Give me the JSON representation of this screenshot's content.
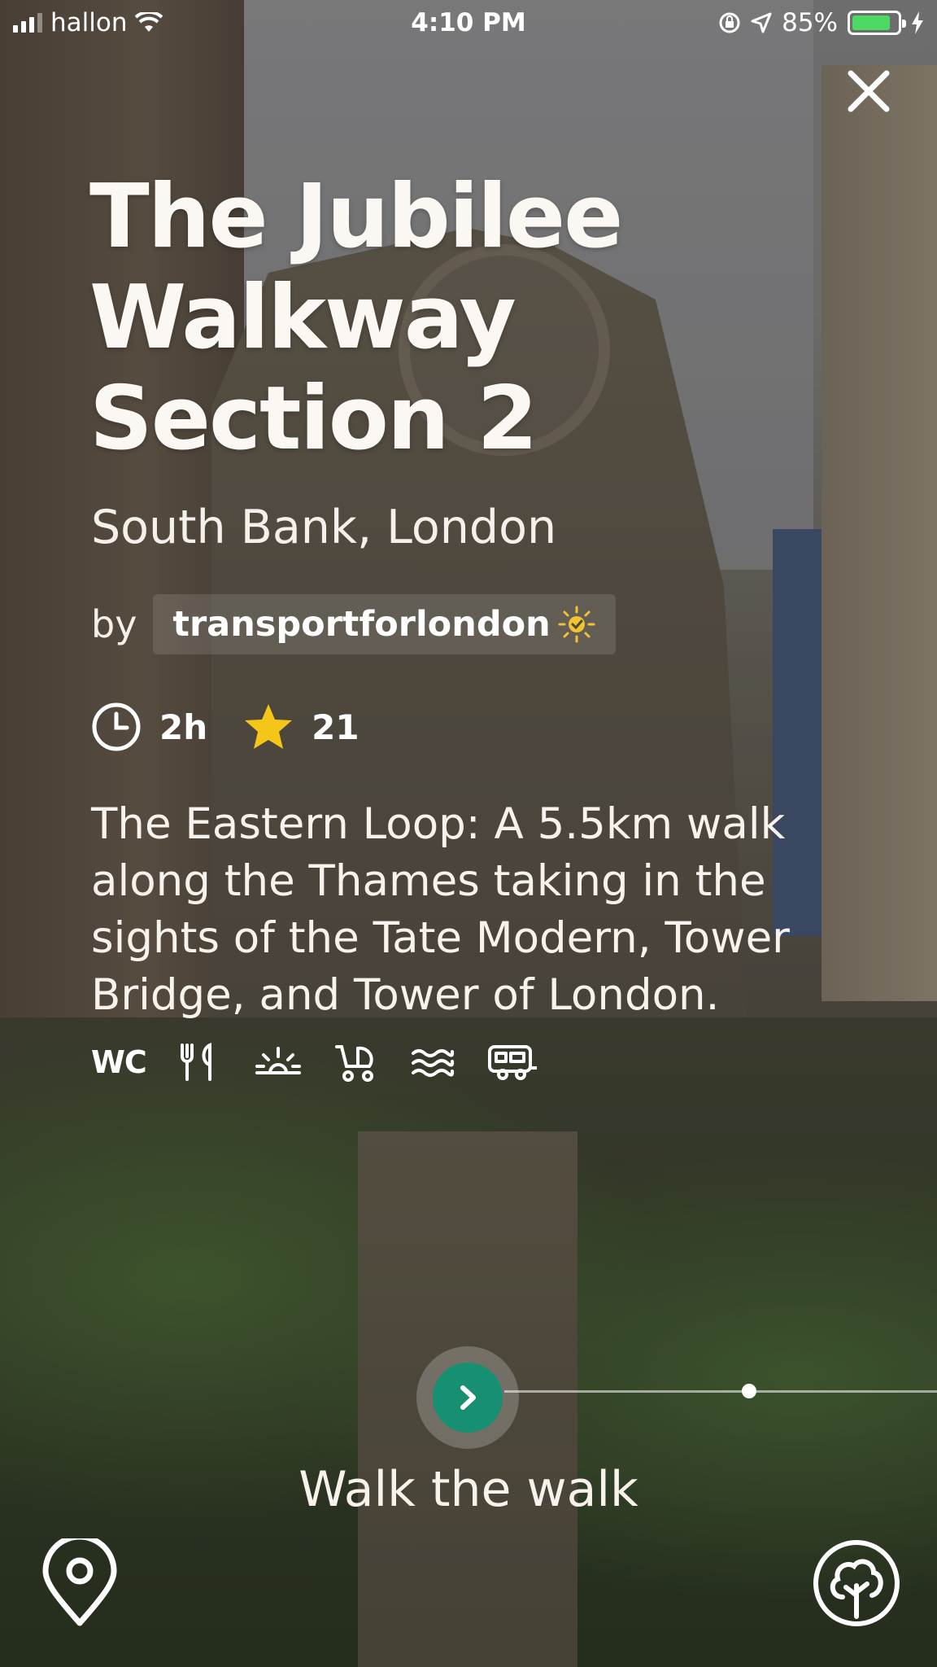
{
  "status_bar": {
    "carrier": "hallon",
    "time": "4:10 PM",
    "battery": "85%",
    "battery_level": 0.85,
    "battery_color": "#4cd964"
  },
  "close_icon": "close-icon",
  "walk": {
    "title_lines": [
      "The Jubilee",
      "Walkway",
      "Section 2"
    ],
    "location": "South Bank, London",
    "by_label": "by",
    "author": "transportforlondon",
    "author_badge_icon": "sun-badge-icon",
    "duration": "2h",
    "rating": "21",
    "description": "The Eastern Loop: A 5.5km walk along the Thames taking in the sights of the Tate Modern, Tower Bridge, and Tower of London.",
    "amenities": [
      {
        "name": "wc",
        "label": "WC"
      },
      {
        "name": "restaurant-icon"
      },
      {
        "name": "sunrise-icon"
      },
      {
        "name": "stroller-icon"
      },
      {
        "name": "water-icon"
      },
      {
        "name": "caravan-icon"
      }
    ]
  },
  "action": {
    "label": "Walk the walk",
    "button_color": "#178f72"
  },
  "accent_colors": {
    "star": "#f5c518",
    "badge": "#f2c230"
  }
}
